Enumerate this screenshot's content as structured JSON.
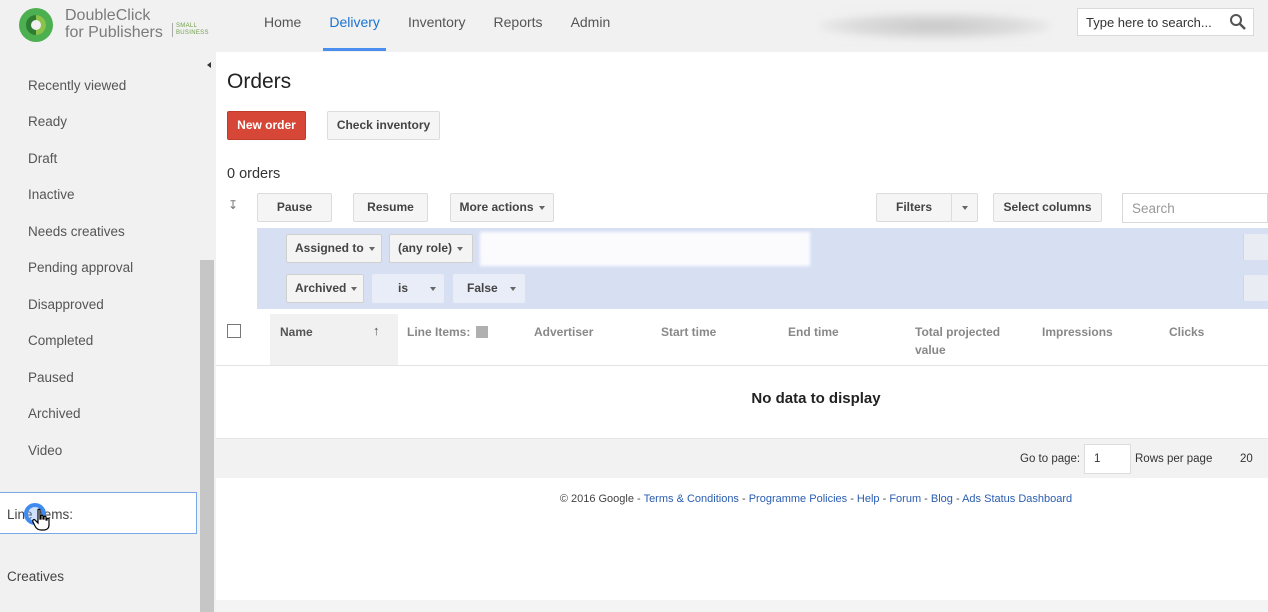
{
  "brand": {
    "line1": "DoubleClick",
    "line2": "for Publishers",
    "small1": "SMALL",
    "small2": "BUSINESS"
  },
  "nav": [
    {
      "label": "Home"
    },
    {
      "label": "Delivery"
    },
    {
      "label": "Inventory"
    },
    {
      "label": "Reports"
    },
    {
      "label": "Admin"
    }
  ],
  "search": {
    "placeholder": "Type here to search..."
  },
  "sidebar": {
    "items": [
      {
        "label": "Recently viewed"
      },
      {
        "label": "Ready"
      },
      {
        "label": "Draft"
      },
      {
        "label": "Inactive"
      },
      {
        "label": "Needs creatives"
      },
      {
        "label": "Pending approval"
      },
      {
        "label": "Disapproved"
      },
      {
        "label": "Completed"
      },
      {
        "label": "Paused"
      },
      {
        "label": "Archived"
      },
      {
        "label": "Video"
      }
    ],
    "section_line_items": "Line Items:",
    "section_creatives": "Creatives"
  },
  "main": {
    "title": "Orders",
    "new_order": "New order",
    "check_inventory": "Check inventory",
    "count": "0 orders",
    "actions": {
      "pause": "Pause",
      "resume": "Resume",
      "more": "More actions",
      "filters": "Filters",
      "select_columns": "Select columns"
    },
    "table_search_placeholder": "Search",
    "filters": {
      "row1": {
        "field": "Assigned to",
        "role": "(any role)"
      },
      "row2": {
        "field": "Archived",
        "op": "is",
        "value": "False"
      }
    },
    "columns": {
      "name": "Name",
      "line_items": "Line Items:",
      "advertiser": "Advertiser",
      "start": "Start time",
      "end": "End time",
      "total_projected": "Total projected value",
      "impressions": "Impressions",
      "clicks": "Clicks"
    },
    "empty": "No data to display",
    "pager": {
      "goto_label": "Go to page:",
      "page": "1",
      "rows_label": "Rows per page",
      "rows": "20"
    }
  },
  "footer": {
    "copyright": "© 2016 Google - ",
    "links": [
      "Terms & Conditions",
      "Programme Policies",
      "Help",
      "Forum",
      "Blog",
      "Ads Status Dashboard"
    ]
  },
  "colors": {
    "accent": "#4a8ef0",
    "primary_button": "#d74737",
    "filter_panel": "#d7dff3",
    "link": "#2a5db0"
  }
}
